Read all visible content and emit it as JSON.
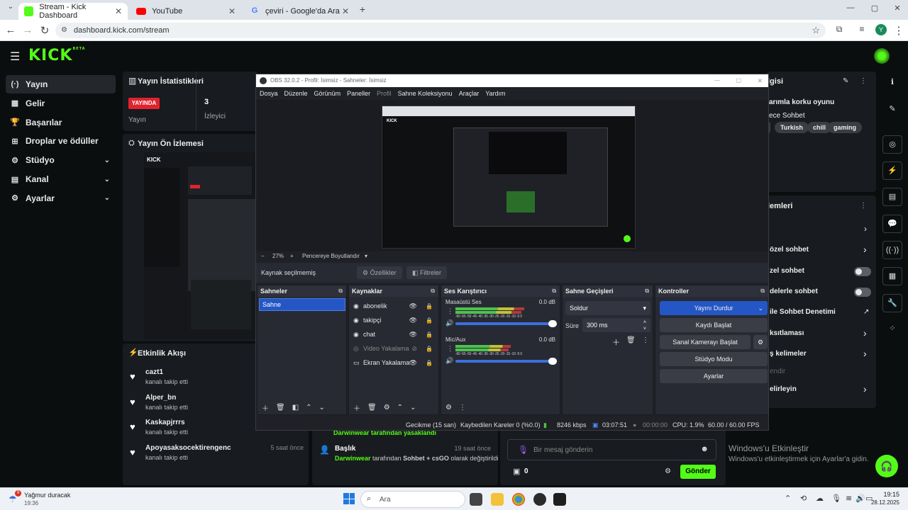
{
  "browser": {
    "tabs": [
      {
        "title": "Stream - Kick Dashboard",
        "active": true,
        "favicon_color": "#53fc18"
      },
      {
        "title": "YouTube",
        "active": false,
        "favicon_color": "#ff0000"
      },
      {
        "title": "çeviri - Google'da Ara",
        "active": false,
        "favicon_color": "#4285f4"
      }
    ],
    "url": "dashboard.kick.com/stream",
    "profile_initial": "Y"
  },
  "kick": {
    "logo": "KICK",
    "logo_badge": "BETA",
    "accent": "#53fc18",
    "sidebar": [
      {
        "icon": "(·)",
        "label": "Yayın",
        "active": true,
        "chevron": false
      },
      {
        "icon": "▦",
        "label": "Gelir",
        "active": false,
        "chevron": false
      },
      {
        "icon": "🏆",
        "label": "Başarılar",
        "active": false,
        "chevron": false
      },
      {
        "icon": "⊞",
        "label": "Droplar ve ödüller",
        "active": false,
        "chevron": false
      },
      {
        "icon": "⚙",
        "label": "Stüdyo",
        "active": false,
        "chevron": true
      },
      {
        "icon": "▤",
        "label": "Kanal",
        "active": false,
        "chevron": true
      },
      {
        "icon": "⚙",
        "label": "Ayarlar",
        "active": false,
        "chevron": true
      }
    ],
    "stats": {
      "title": "Yayın İstatistikleri",
      "live_badge": "YAYINDA",
      "stream_label": "Yayın",
      "viewers_value": "3",
      "viewers_label": "İzleyici"
    },
    "preview": {
      "title": "Yayın Ön İzlemesi"
    },
    "activity": {
      "title": "Etkinlik Akışı",
      "items": [
        {
          "name": "cazt1",
          "action": "kanalı takip etti",
          "time": ""
        },
        {
          "name": "Alper_bn",
          "action": "kanalı takip etti",
          "time": ""
        },
        {
          "name": "Kaskapjrrrs",
          "action": "kanalı takip etti",
          "time": ""
        },
        {
          "name": "Apoyasaksocektirengenc",
          "action": "kanalı takip etti",
          "time": "5 saat önce"
        }
      ]
    },
    "mod_log": {
      "partial_text": "Darwinwear tarafından yasaklandı",
      "item_title": "Başlık",
      "item_time": "19 saat önce",
      "item_user": "Darwinwear",
      "item_middle": "tarafından",
      "item_value": "Sohbet + csGO",
      "item_end": "olarak değiştirildi"
    },
    "chat": {
      "placeholder": "Bir mesaj gönderin",
      "points": "0",
      "send_label": "Gönder"
    },
    "right_panel": {
      "info_title_partial": "lgisi",
      "stream_title_partial": "arımla korku oyunu",
      "category_partial": "ece Sohbet",
      "tags": [
        "Turkish",
        "chill",
        "gaming"
      ],
      "settings_title_partial": "lemleri",
      "rows": [
        {
          "label": "özel sohbet",
          "control": "chevron"
        },
        {
          "label": "zel sohbet",
          "control": "toggle"
        },
        {
          "label": "delerle sohbet",
          "control": "toggle"
        },
        {
          "label": "ile Sohbet Denetimi",
          "control": "external"
        },
        {
          "label": "ksıtlaması",
          "control": "chevron"
        },
        {
          "label": "ş kelimeler",
          "control": "chevron"
        },
        {
          "label": "endir",
          "control": "none"
        },
        {
          "label": "elirleyin",
          "control": "chevron"
        }
      ]
    }
  },
  "obs": {
    "title": "OBS 32.0.2 - Profil: İsimsiz - Sahneler: İsimsiz",
    "menu": [
      "Dosya",
      "Düzenle",
      "Görünüm",
      "Paneller",
      "Profil",
      "Sahne Koleksiyonu",
      "Araçlar",
      "Yardım"
    ],
    "zoom": "27%",
    "fit_label": "Pencereye Boyutlandır",
    "no_source": "Kaynak seçilmemiş",
    "properties_label": "Özellikler",
    "filters_label": "Filtreler",
    "scenes_title": "Sahneler",
    "scenes": [
      "Sahne"
    ],
    "sources_title": "Kaynaklar",
    "sources": [
      {
        "name": "abonelik",
        "icon": "globe-icon",
        "dim": false
      },
      {
        "name": "takipçi",
        "icon": "globe-icon",
        "dim": false
      },
      {
        "name": "chat",
        "icon": "globe-icon",
        "dim": false
      },
      {
        "name": "Video Yakalama",
        "icon": "camera-icon",
        "dim": true
      },
      {
        "name": "Ekran Yakalama",
        "icon": "monitor-icon",
        "dim": false
      }
    ],
    "mixer_title": "Ses Karıştırıcı",
    "mixer": [
      {
        "name": "Masaüstü Ses",
        "db": "0.0 dB",
        "level": 0.68
      },
      {
        "name": "Mic/Aux",
        "db": "0.0 dB",
        "level": 0.55
      }
    ],
    "mixer_ticks": "-60 -55 -50 -45 -40 -35 -30 -25 -20 -15 -10 -5 0",
    "transitions_title": "Sahne Geçişleri",
    "transition": "Soldur",
    "duration_label": "Süre",
    "duration": "300 ms",
    "controls_title": "Kontroller",
    "controls": [
      "Yayını Durdur",
      "Kaydı Başlat",
      "Sanal Kamerayı Başlat",
      "Stüdyo Modu",
      "Ayarlar"
    ],
    "status": {
      "delay": "Gecikme (15 san)",
      "dropped": "Kaybedilen Kareler 0 (%0.0)",
      "bitrate": "8246 kbps",
      "live_time": "03:07:51",
      "rec_time": "00:00:00",
      "cpu": "CPU: 1.9%",
      "fps": "60.00 / 60.00 FPS"
    }
  },
  "activation": {
    "title": "Windows'u Etkinleştir",
    "text": "Windows'u etkinleştirmek için Ayarlar'a gidin."
  },
  "taskbar": {
    "weather_badge": "9",
    "weather_title": "Yağmur duracak",
    "weather_time": "19:36",
    "search_placeholder": "Ara",
    "clock_time": "19:15",
    "clock_date": "28.12.2025"
  }
}
